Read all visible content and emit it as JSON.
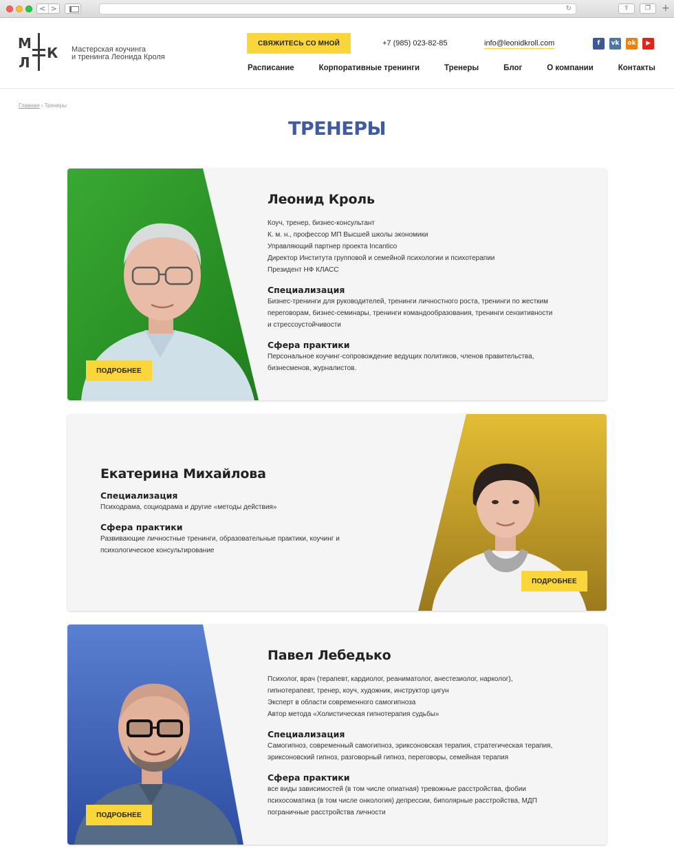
{
  "browser": {
    "back": "<",
    "forward": ">",
    "reload": "↻",
    "share": "⇧",
    "tabs": "❐",
    "new_tab": "+"
  },
  "header": {
    "logo_letters": [
      "М",
      "К",
      "Л"
    ],
    "tagline_line1": "Мастерская коучинга",
    "tagline_line2": "и тренинга Леонида Кроля",
    "cta_label": "СВЯЖИТЕСЬ СО МНОЙ",
    "phone": "+7 (985) 023-82-85",
    "email": "info@leonidkroll.com",
    "socials": [
      {
        "name": "facebook",
        "glyph": "f"
      },
      {
        "name": "vk",
        "glyph": "vk"
      },
      {
        "name": "odnoklassniki",
        "glyph": "ok"
      },
      {
        "name": "youtube",
        "glyph": "▶"
      }
    ],
    "menu": [
      "Расписание",
      "Корпоративные тренинги",
      "Тренеры",
      "Блог",
      "О компании",
      "Контакты"
    ]
  },
  "breadcrumbs": {
    "home": "Главная",
    "separator": "›",
    "current": "Тренеры"
  },
  "page_title": "ТРЕНЕРЫ",
  "colors": {
    "accent_yellow": "#fbd63a",
    "title_blue": "#3e5ba3",
    "green_bg": "#2f9c2a",
    "gold_bg": "#c9a52a",
    "blue_bg": "#3f63b8"
  },
  "trainers": [
    {
      "name": "Леонид Кроль",
      "lines": [
        "Коуч, тренер, бизнес-консультант",
        "К. м. н., профессор МП Высшей школы экономики",
        "Управляющий партнер проекта Incantico",
        "Директор Института групповой и семейной психологии и психотерапии",
        "Президент НФ КЛАСС"
      ],
      "specialization_label": "Специализация",
      "specialization_lines": [
        "Бизнес-тренинги для руководителей, тренинги личностного роста, тренинги по жестким",
        "переговорам, бизнес-семинары, тренинги командообразования, тренинги сензитивности",
        "и стрессоустойчивости"
      ],
      "practice_label": "Сфера практики",
      "practice_lines": [
        "Персональное коучинг-сопровождение ведущих политиков, членов правительства,",
        "бизнесменов, журналистов."
      ],
      "more_label": "ПОДРОБНЕЕ"
    },
    {
      "name": "Екатерина Михайлова",
      "specialization_label": "Специализация",
      "specialization_lines": [
        "Психодрама, социодрама и другие «методы действия»"
      ],
      "practice_label": "Сфера практики",
      "practice_lines": [
        "Развивающие личностные тренинги, образовательные практики, коучинг и",
        "психологическое консультирование"
      ],
      "more_label": "ПОДРОБНЕЕ"
    },
    {
      "name": "Павел Лебедько",
      "lines": [
        "Психолог, врач (терапевт, кардиолог, реаниматолог, анестезиолог, нарколог),",
        "гипнотерапевт, тренер, коуч, художник, инструктор цигун",
        "Эксперт в области современного самогипноза",
        "Автор метода «Холистическая гипнотерапия судьбы»"
      ],
      "specialization_label": "Специализация",
      "specialization_lines": [
        "Самогипноз, современный самогипноз, эриксоновская терапия, стратегическая терапия,",
        "эриксоновский гипноз, разговорный гипноз, переговоры, семейная терапия"
      ],
      "practice_label": "Сфера практики",
      "practice_lines": [
        "все виды зависимостей (в том числе опиатная) тревожные расстройства, фобии",
        "психосоматика (в том числе онкология) депрессии, биполярные расстройства, МДП",
        "пограничные расстройства личности"
      ],
      "more_label": "ПОДРОБНЕЕ"
    }
  ]
}
